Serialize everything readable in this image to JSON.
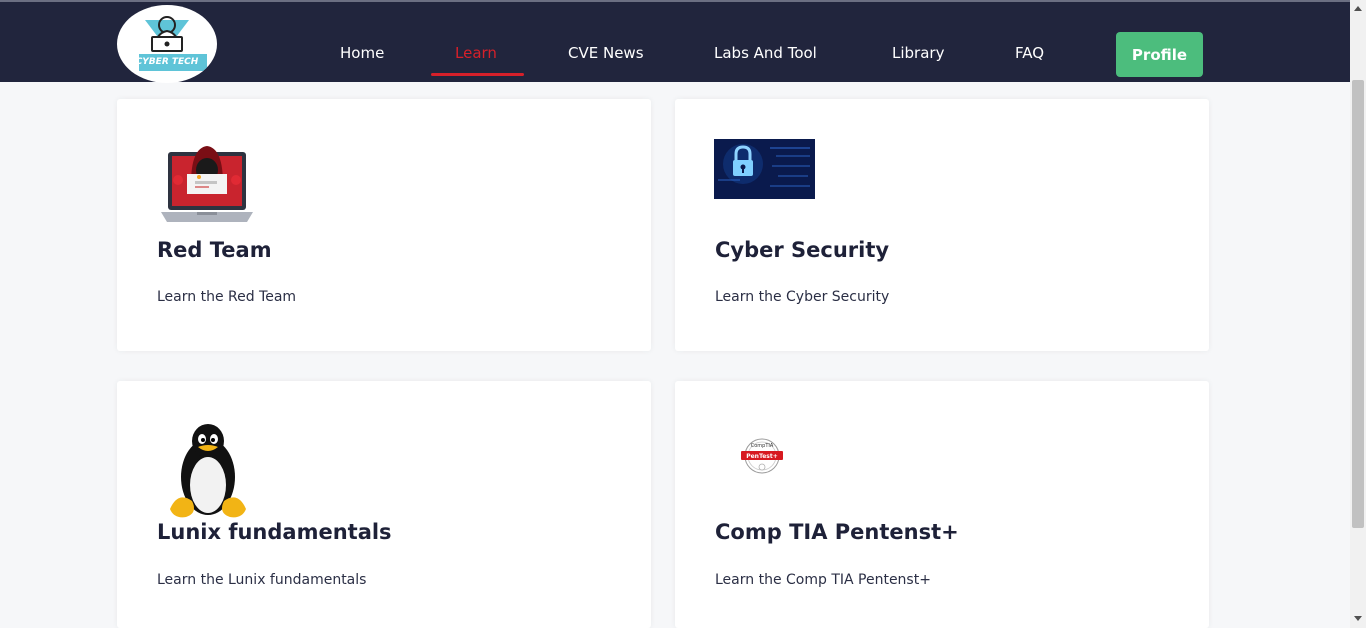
{
  "brand": {
    "logo_text": "CYBER TECH",
    "accent": "#d6202a",
    "nav_bg": "#21253d",
    "button_green": "#4cbd7d"
  },
  "nav": {
    "items": [
      {
        "label": "Home"
      },
      {
        "label": "Learn",
        "active": true
      },
      {
        "label": "CVE News"
      },
      {
        "label": "Labs And Tool"
      },
      {
        "label": "Library"
      },
      {
        "label": "FAQ"
      }
    ],
    "profile_label": "Profile"
  },
  "cards": [
    {
      "title": "Red Team",
      "description": "Learn the Red Team",
      "icon": "hacker-laptop-icon"
    },
    {
      "title": "Cyber Security",
      "description": "Learn the Cyber Security",
      "icon": "padlock-circuit-icon"
    },
    {
      "title": "Lunix fundamentals",
      "description": "Learn the Lunix fundamentals",
      "icon": "tux-penguin-icon"
    },
    {
      "title": "Comp TIA Pentenst+",
      "description": "Learn the Comp TIA Pentenst+",
      "icon": "pentest-badge-icon",
      "badge_lines": [
        "CompTIA",
        "PenTest+"
      ]
    }
  ]
}
